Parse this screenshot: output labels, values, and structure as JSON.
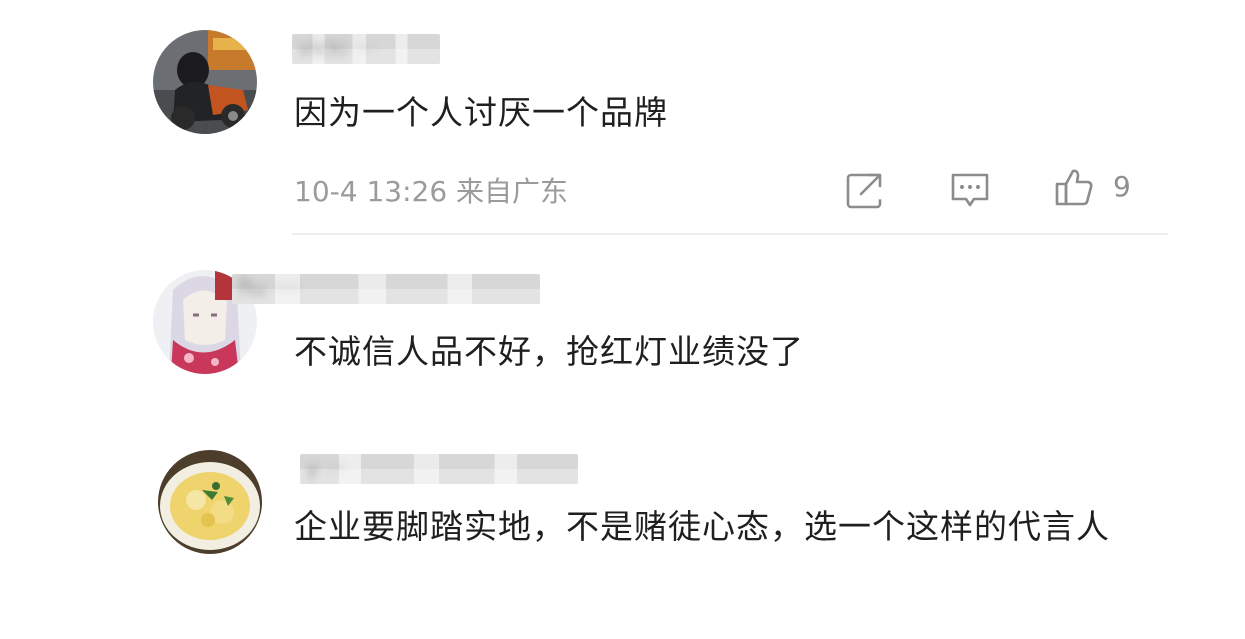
{
  "comments": [
    {
      "username": "vicki ···",
      "text": "因为一个人讨厌一个品牌",
      "meta": "10-4 13:26 来自广东",
      "likes": "9",
      "avatar_icon": "motorcycle-rider-avatar"
    },
    {
      "username": "Ru ····",
      "text": "不诚信人品不好，抢红灯业绩没了",
      "avatar_icon": "anime-girl-avatar"
    },
    {
      "username": "y ···",
      "text": "企业要脚踏实地，不是赌徒心态，选一个这样的代言人",
      "avatar_icon": "food-plate-avatar"
    }
  ],
  "actions": {
    "share_icon": "share-icon",
    "reply_icon": "comment-icon",
    "like_icon": "thumbs-up-icon"
  }
}
